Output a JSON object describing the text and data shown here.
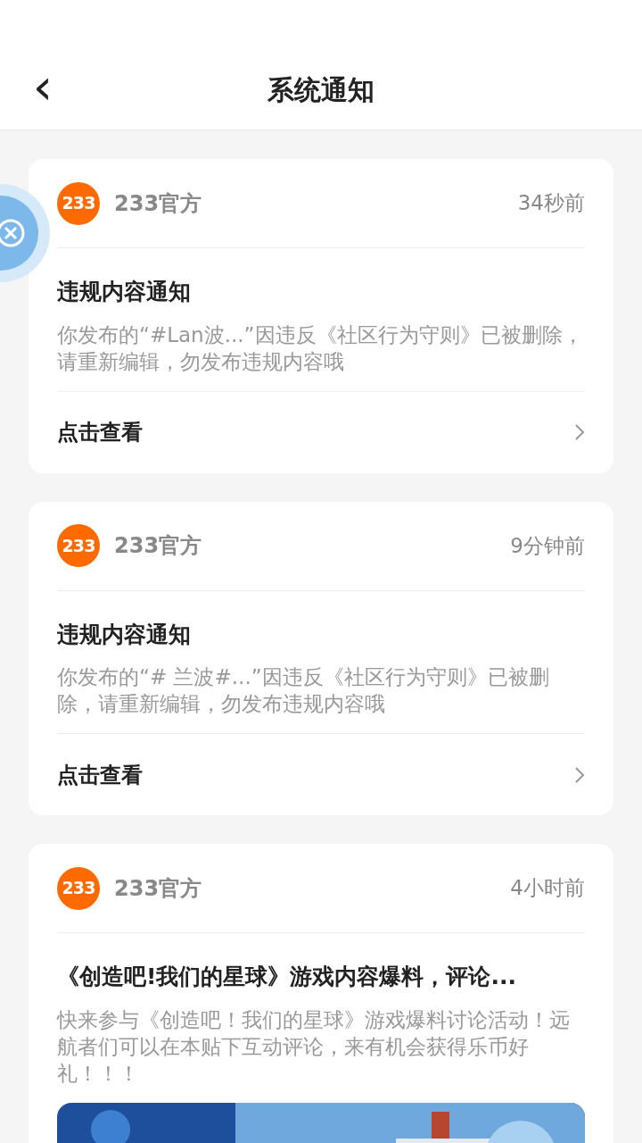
{
  "header": {
    "back": "‹",
    "title": "系统通知"
  },
  "notifications": [
    {
      "logo": "233",
      "sender": "233官方",
      "time": "34秒前",
      "title": "违规内容通知",
      "body": "你发布的“#Lan波...”因违反《社区行为守则》已被删除，请重新编辑，勿发布违规内容哦",
      "action": "点击查看",
      "kind": "text"
    },
    {
      "logo": "233",
      "sender": "233官方",
      "time": "9分钟前",
      "title": "违规内容通知",
      "body": "你发布的“# 兰波#...”因违反《社区行为守则》已被删除，请重新编辑，勿发布违规内容哦",
      "action": "点击查看",
      "kind": "text"
    },
    {
      "logo": "233",
      "sender": "233官方",
      "time": "4小时前",
      "title": "《创造吧!我们的星球》游戏内容爆料，评论...",
      "body": "快来参与《创造吧！我们的星球》游戏爆料讨论活动！远航者们可以在本贴下互动评论，来有机会获得乐币好礼！！！"
    }
  ]
}
